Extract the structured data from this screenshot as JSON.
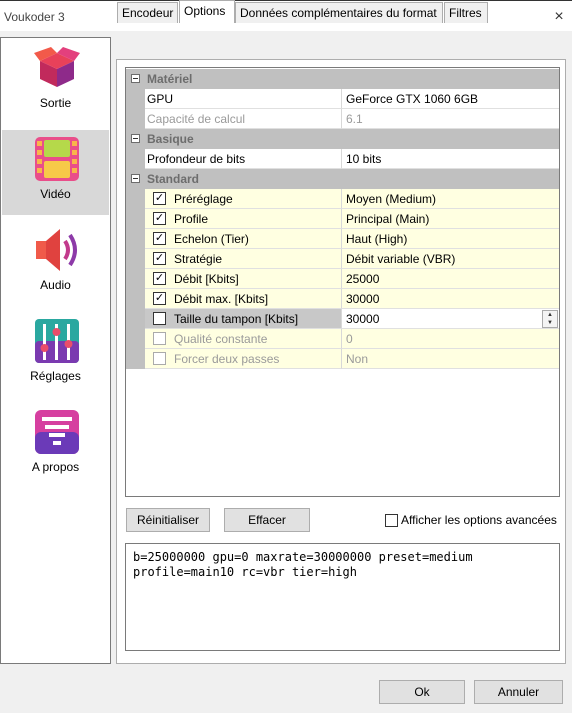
{
  "window": {
    "title": "Voukoder 3",
    "close_icon": "×"
  },
  "sidebar": {
    "items": [
      {
        "label": "Sortie",
        "icon": "box-icon"
      },
      {
        "label": "Vidéo",
        "icon": "film-icon"
      },
      {
        "label": "Audio",
        "icon": "speaker-icon"
      },
      {
        "label": "Réglages",
        "icon": "sliders-icon"
      },
      {
        "label": "A propos",
        "icon": "tornado-icon"
      }
    ],
    "active": "Vidéo"
  },
  "tabs": [
    "Encodeur",
    "Options",
    "Données complémentaires du format",
    "Filtres"
  ],
  "active_tab": "Options",
  "grid": {
    "categories": {
      "materiel": "Matériel",
      "basique": "Basique",
      "standard": "Standard"
    },
    "rows": {
      "gpu": {
        "name": "GPU",
        "value": "GeForce GTX 1060 6GB"
      },
      "capacite": {
        "name": "Capacité de calcul",
        "value": "6.1"
      },
      "profondeur": {
        "name": "Profondeur de bits",
        "value": "10 bits"
      },
      "preset": {
        "name": "Préréglage",
        "value": "Moyen (Medium)",
        "checked": true
      },
      "profile": {
        "name": "Profile",
        "value": "Principal (Main)",
        "checked": true
      },
      "tier": {
        "name": "Echelon (Tier)",
        "value": "Haut (High)",
        "checked": true
      },
      "strategie": {
        "name": "Stratégie",
        "value": "Débit variable (VBR)",
        "checked": true
      },
      "debit": {
        "name": "Débit [Kbits]",
        "value": "25000",
        "checked": true
      },
      "debitmax": {
        "name": "Débit max. [Kbits]",
        "value": "30000",
        "checked": true
      },
      "tampon": {
        "name": "Taille du tampon [Kbits]",
        "value": "30000",
        "checked": false
      },
      "qualite": {
        "name": "Qualité constante",
        "value": "0",
        "checked": false
      },
      "passes": {
        "name": "Forcer deux passes",
        "value": "Non",
        "checked": false
      }
    },
    "check_mark": "✓"
  },
  "buttons": {
    "reset": "Réinitialiser",
    "clear": "Effacer",
    "advanced": "Afficher les options avancées",
    "ok": "Ok",
    "cancel": "Annuler"
  },
  "command_line": "b=25000000 gpu=0 maxrate=30000000 preset=medium\nprofile=main10 rc=vbr tier=high",
  "colors": {
    "category": "#c0c0c0",
    "yellow_row": "#ffffe1",
    "active_side": "#d8d8d8"
  }
}
